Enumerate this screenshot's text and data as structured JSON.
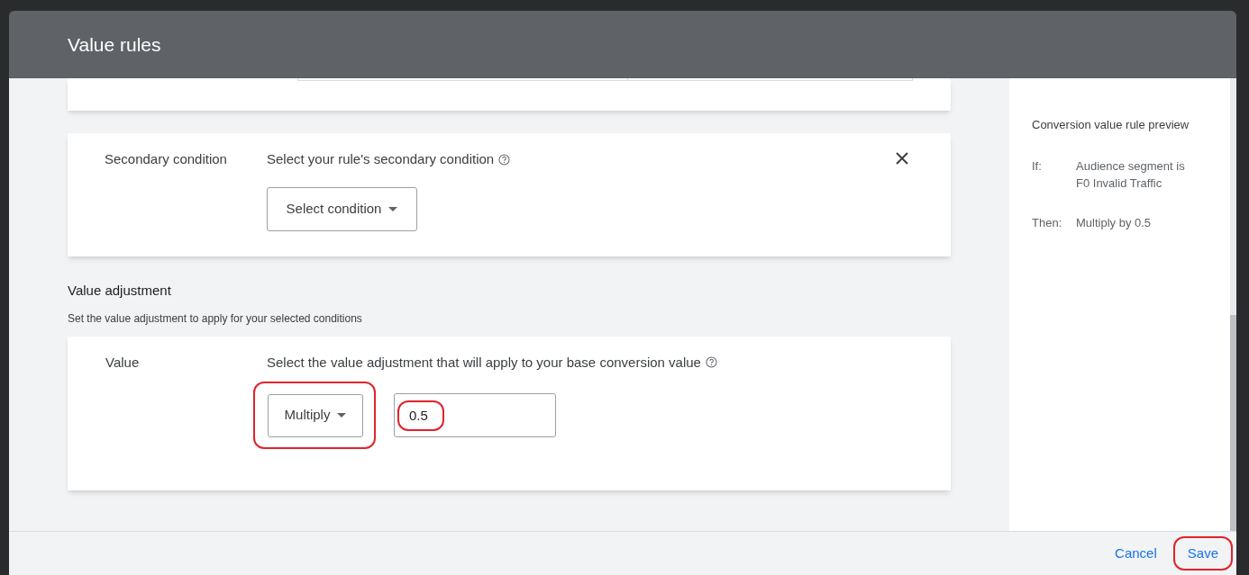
{
  "window": {
    "title": "Value rules"
  },
  "secondary_condition": {
    "label": "Secondary condition",
    "question": "Select your rule's secondary condition",
    "dropdown": {
      "value": "Select condition"
    }
  },
  "value_adjustment": {
    "heading": "Value adjustment",
    "description": "Set the value adjustment to apply for your selected conditions",
    "label": "Value",
    "question": "Select the value adjustment that will apply to your base conversion value",
    "operation": {
      "value": "Multiply",
      "highlighted": true
    },
    "amount": {
      "value": "0.5",
      "highlighted": true
    }
  },
  "preview": {
    "title": "Conversion value rule preview",
    "rows": [
      {
        "label": "If:",
        "text": "Audience segment is F0 Invalid Traffic"
      },
      {
        "label": "Then:",
        "text": "Multiply by 0.5"
      }
    ]
  },
  "buttons": [
    {
      "label": "Cancel",
      "highlighted": false
    },
    {
      "label": "Save",
      "highlighted": true
    }
  ]
}
